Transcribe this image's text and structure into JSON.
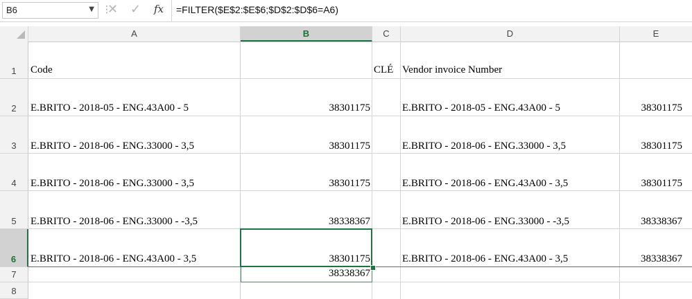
{
  "formula_bar": {
    "name_box": "B6",
    "formula": "=FILTER($E$2:$E$6;$D$2:$D$6=A6)",
    "fx_label": "fx"
  },
  "columns": [
    "A",
    "B",
    "C",
    "D",
    "E"
  ],
  "rows": [
    "1",
    "2",
    "3",
    "4",
    "5",
    "6",
    "7",
    "8"
  ],
  "cells": {
    "A1": "Code",
    "C1": "CLÉ",
    "D1": "Vendor invoice Number",
    "A2": "E.BRITO - 2018-05 - ENG.43A00 - 5",
    "B2": "38301175",
    "D2": "E.BRITO - 2018-05 - ENG.43A00 - 5",
    "E2": "38301175",
    "A3": "E.BRITO - 2018-06 - ENG.33000 - 3,5",
    "B3": "38301175",
    "D3": "E.BRITO - 2018-06 - ENG.33000 - 3,5",
    "E3": "38301175",
    "A4": "E.BRITO - 2018-06 - ENG.33000 - 3,5",
    "B4": "38301175",
    "D4": "E.BRITO - 2018-06 - ENG.43A00 - 3,5",
    "E4": "38301175",
    "A5": "E.BRITO - 2018-06 - ENG.33000 - -3,5",
    "B5": "38338367",
    "D5": "E.BRITO - 2018-06 - ENG.33000 - -3,5",
    "E5": "38338367",
    "A6": "E.BRITO - 2018-06 - ENG.43A00 - 3,5",
    "B6": "38301175",
    "D6": "E.BRITO - 2018-06 - ENG.43A00 - 3,5",
    "E6": "38338367",
    "B7": "38338367"
  },
  "colors": {
    "selection": "#217346",
    "header_bg": "#f2f2f2",
    "gridline": "#d4d4d4"
  }
}
